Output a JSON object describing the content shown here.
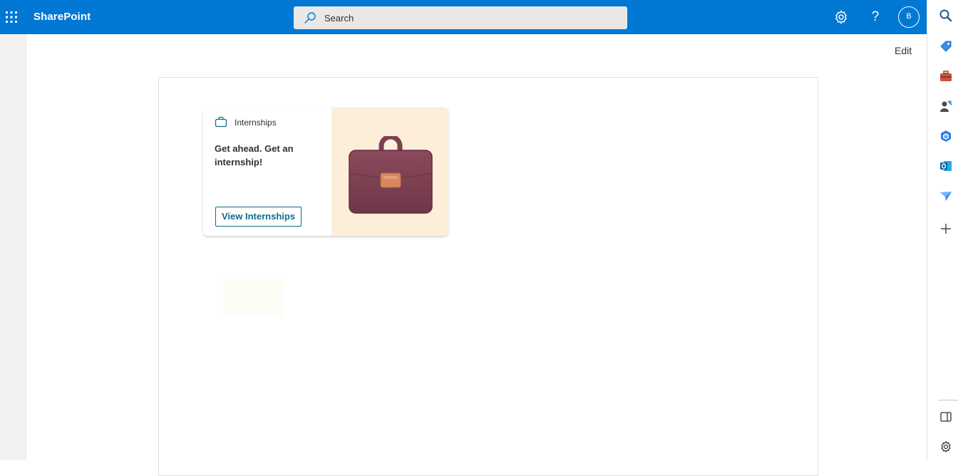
{
  "topbar": {
    "app_name": "SharePoint",
    "search_placeholder": "Search",
    "avatar_initial": "B",
    "help_label": "?"
  },
  "page": {
    "edit_label": "Edit"
  },
  "card": {
    "header_label": "Internships",
    "title": "Get ahead. Get an internship!",
    "button_label": "View Internships"
  },
  "rail": {
    "items": [
      "search-icon",
      "tag-icon",
      "toolbox-icon",
      "people-icon",
      "teams-icon",
      "outlook-icon",
      "send-icon",
      "add-icon"
    ],
    "bottom": [
      "side-panel-icon",
      "settings-icon"
    ]
  },
  "colors": {
    "suitebar": "#0078d4",
    "accent": "#0f6c87",
    "card_image_bg": "#fdeeda",
    "briefcase": "#7b3f52"
  }
}
